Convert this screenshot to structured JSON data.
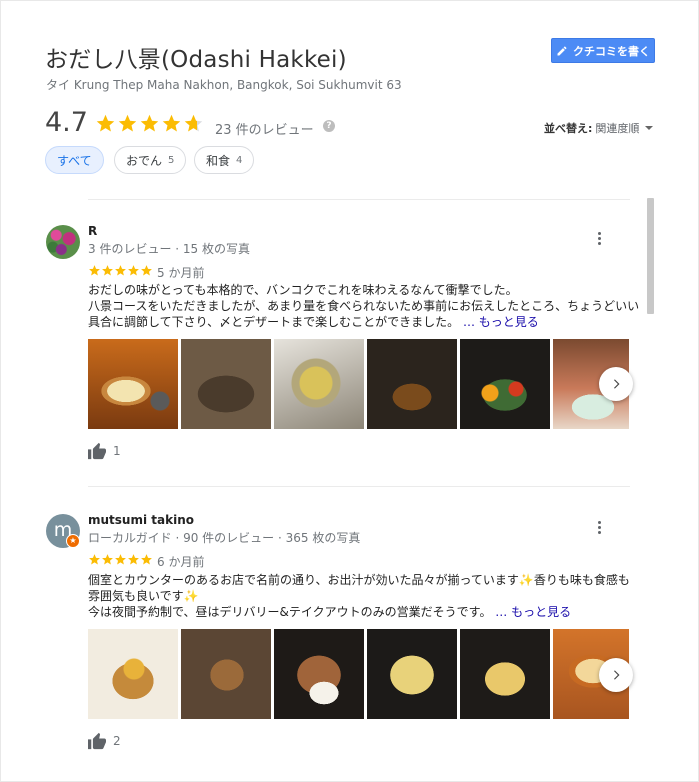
{
  "place": {
    "title": "おだし八景(Odashi Hakkei)",
    "address": "タイ Krung Thep Maha Nakhon, Bangkok, Soi Sukhumvit 63"
  },
  "write_review": {
    "label": "クチコミを書く",
    "icon": "pencil-icon"
  },
  "summary": {
    "rating": "4.7",
    "rating_value": 4.7,
    "review_count": "23 件のレビュー",
    "help": "?"
  },
  "sort": {
    "label": "並べ替え:",
    "value": "関連度順"
  },
  "filters": [
    {
      "label": "すべて",
      "count": ""
    },
    {
      "label": "おでん",
      "count": "5"
    },
    {
      "label": "和食",
      "count": "4"
    }
  ],
  "colors": {
    "star": "#fbbc04",
    "accent": "#4c8bf5",
    "link": "#1a0dab",
    "guide_badge": "#ef6c00"
  },
  "reviews": [
    {
      "name": "R",
      "avatar": "flower-photo",
      "meta": "3 件のレビュー · 15 枚の写真",
      "stars": 5,
      "date": "5 か月前",
      "lines": [
        "おだしの味がとっても本格的で、バンコクでこれを味わえるなんて衝撃でした。",
        "八景コースをいただきましたが、あまり量を食べられないため事前にお伝えしたところ、ちょうどいい",
        "具合に調節して下さり、〆とデザートまで楽しむことができました。 "
      ],
      "more": "… もっと見る",
      "likes": "1"
    },
    {
      "name": "mutsumi takino",
      "avatar_letter": "m",
      "meta": "ローカルガイド · 90 件のレビュー · 365 枚の写真",
      "stars": 5,
      "date": "6 か月前",
      "lines": [
        "個室とカウンターのあるお店で名前の通り、お出汁が効いた品々が揃っています✨香りも味も食感も",
        "雰囲気も良いです✨",
        "今は夜間予約制で、昼はデリバリー&テイクアウトのみの営業だそうです。 "
      ],
      "more": "… もっと見る",
      "likes": "2"
    }
  ]
}
